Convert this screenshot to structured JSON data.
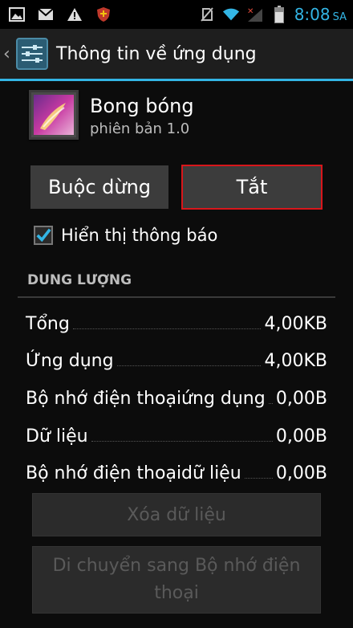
{
  "statusbar": {
    "time": "8:08",
    "ampm": "SA",
    "icons": [
      "image-icon",
      "gmail-icon",
      "warning-icon",
      "shield-icon",
      "no-sim-icon",
      "wifi-icon",
      "no-signal-icon",
      "battery-icon"
    ]
  },
  "actionbar": {
    "title": "Thông tin về ứng dụng"
  },
  "app": {
    "name": "Bong bóng",
    "version": "phiên bản 1.0"
  },
  "buttons": {
    "force_stop": "Buộc dừng",
    "disable": "Tắt"
  },
  "notifications": {
    "label": "Hiển thị thông báo",
    "checked": true
  },
  "storage": {
    "header": "DUNG LƯỢNG",
    "rows": [
      {
        "label": "Tổng",
        "value": "4,00KB"
      },
      {
        "label": "Ứng dụng",
        "value": "4,00KB"
      },
      {
        "label": "Bộ nhớ điện thoạiứng dụng",
        "value": "0,00B"
      },
      {
        "label": "Dữ liệu",
        "value": "0,00B"
      },
      {
        "label": "Bộ nhớ điện thoạidữ liệu",
        "value": "0,00B"
      }
    ],
    "clear_data": "Xóa dữ liệu",
    "move": "Di chuyển sang Bộ nhớ điện thoại"
  },
  "colors": {
    "accent": "#33b5e5",
    "highlight_border": "#d8161b"
  }
}
